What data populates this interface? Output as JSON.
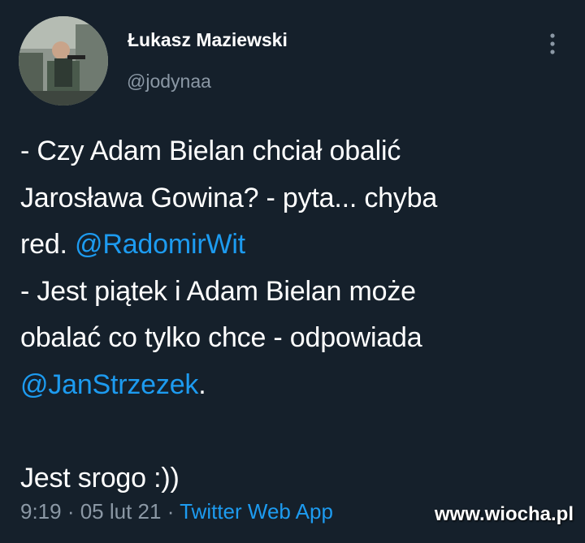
{
  "tweet": {
    "author": {
      "display_name": "Łukasz Maziewski",
      "handle": "@jodynaa",
      "avatar_icon": "avatar-photo"
    },
    "more_icon": "more-vertical-icon",
    "text": {
      "line1": "- Czy Adam Bielan chciał obalić",
      "line2": "Jarosława Gowina? - pyta... chyba",
      "line3_prefix": "red. ",
      "mention1": "@RadomirWit",
      "line4": "- Jest piątek i Adam Bielan może",
      "line5": "obalać co tylko chce - odpowiada",
      "mention2": "@JanStrzezek",
      "line6_suffix": ".",
      "line7": "Jest srogo :))"
    },
    "meta": {
      "time": "9:19",
      "sep1": " · ",
      "date": "05 lut 21",
      "sep2": " · ",
      "source": "Twitter Web App"
    }
  },
  "watermark": "www.wiocha.pl",
  "colors": {
    "background": "#15202b",
    "text": "#ffffff",
    "secondary": "#8b98a5",
    "link": "#1d9bf0"
  }
}
